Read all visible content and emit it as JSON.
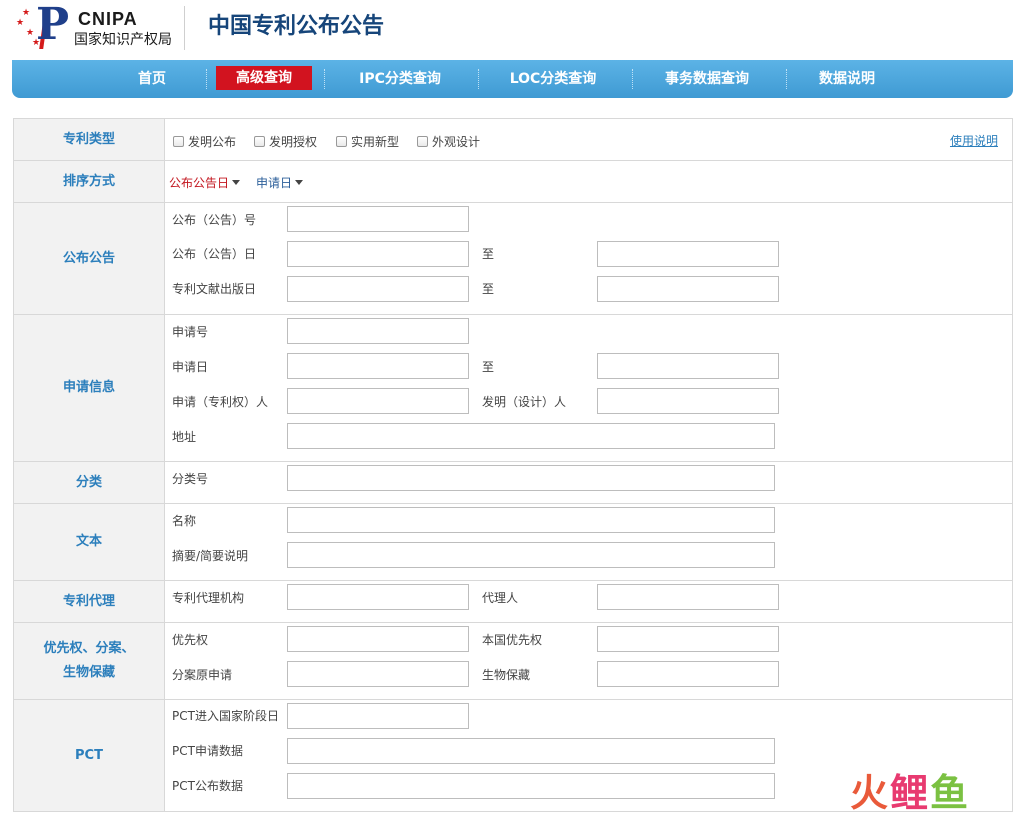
{
  "header": {
    "logo_en": "CNIPA",
    "logo_cn": "国家知识产权局",
    "title": "中国专利公布公告"
  },
  "nav": {
    "items": [
      {
        "label": "首页",
        "active": false
      },
      {
        "label": "高级查询",
        "active": true
      },
      {
        "label": "IPC分类查询",
        "active": false
      },
      {
        "label": "LOC分类查询",
        "active": false
      },
      {
        "label": "事务数据查询",
        "active": false
      },
      {
        "label": "数据说明",
        "active": false
      }
    ]
  },
  "form": {
    "patent_type": {
      "label": "专利类型",
      "options": [
        {
          "label": "发明公布",
          "checked": false
        },
        {
          "label": "发明授权",
          "checked": false
        },
        {
          "label": "实用新型",
          "checked": false
        },
        {
          "label": "外观设计",
          "checked": false
        }
      ],
      "help_link": "使用说明"
    },
    "sort": {
      "label": "排序方式",
      "options": [
        {
          "label": "公布公告日",
          "active": true
        },
        {
          "label": "申请日",
          "active": false
        }
      ]
    },
    "publication": {
      "label": "公布公告",
      "pub_no": "公布（公告）号",
      "pub_date": "公布（公告）日",
      "doc_pub_date": "专利文献出版日",
      "to": "至"
    },
    "application": {
      "label": "申请信息",
      "app_no": "申请号",
      "app_date": "申请日",
      "to": "至",
      "applicant": "申请（专利权）人",
      "inventor": "发明（设计）人",
      "address": "地址"
    },
    "classification": {
      "label": "分类",
      "class_no": "分类号"
    },
    "text": {
      "label": "文本",
      "name": "名称",
      "abstract": "摘要/简要说明"
    },
    "agency": {
      "label": "专利代理",
      "agency_org": "专利代理机构",
      "agent": "代理人"
    },
    "priority": {
      "label_line1": "优先权、分案、",
      "label_line2": "生物保藏",
      "priority": "优先权",
      "domestic_priority": "本国优先权",
      "divisional": "分案原申请",
      "bio_deposit": "生物保藏"
    },
    "pct": {
      "label": "PCT",
      "national_phase": "PCT进入国家阶段日",
      "app_data": "PCT申请数据",
      "pub_data": "PCT公布数据"
    }
  },
  "watermark": {
    "c1": "火",
    "c2": "鲤",
    "c3": "鱼"
  },
  "colors": {
    "nav_bg": "#4aa5dc",
    "nav_active": "#d2131f",
    "label_blue": "#2c7fbc",
    "title_blue": "#16457a"
  }
}
